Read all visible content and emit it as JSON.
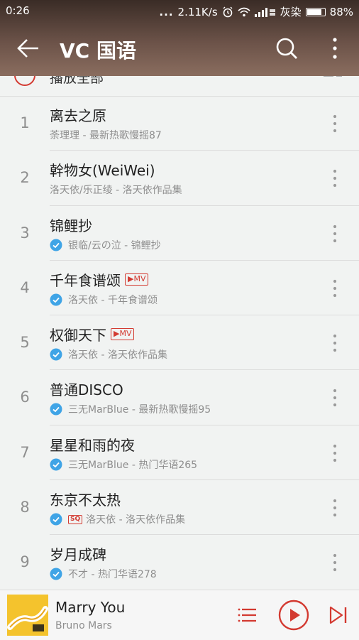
{
  "status_bar": {
    "time": "0:26",
    "dots": "...",
    "speed": "2.11K/s",
    "carrier": "灰染",
    "battery_text": "88%",
    "battery_level": 0.88
  },
  "header": {
    "title": "VC 国语",
    "back_icon": "back-arrow-icon",
    "search_icon": "search-icon",
    "more_icon": "more-vertical-icon"
  },
  "play_all": {
    "label": "播放全部"
  },
  "songs": [
    {
      "index": "1",
      "title": "离去之原",
      "subtitle": "荼理理 - 最新热歌慢摇87",
      "verified": false,
      "mv": false,
      "sq": false
    },
    {
      "index": "2",
      "title": "幹物女(WeiWei)",
      "subtitle": "洛天依/乐正绫 - 洛天依作品集",
      "verified": false,
      "mv": false,
      "sq": false
    },
    {
      "index": "3",
      "title": "锦鲤抄",
      "subtitle": "银临/云の泣 - 锦鲤抄",
      "verified": true,
      "mv": false,
      "sq": false
    },
    {
      "index": "4",
      "title": "千年食谱颂",
      "subtitle": "洛天依 - 千年食谱颂",
      "verified": true,
      "mv": true,
      "sq": false
    },
    {
      "index": "5",
      "title": "权御天下",
      "subtitle": "洛天依 - 洛天依作品集",
      "verified": true,
      "mv": true,
      "sq": false
    },
    {
      "index": "6",
      "title": "普通DISCO",
      "subtitle": "三无MarBlue - 最新热歌慢摇95",
      "verified": true,
      "mv": false,
      "sq": false
    },
    {
      "index": "7",
      "title": "星星和雨的夜",
      "subtitle": "三无MarBlue - 热门华语265",
      "verified": true,
      "mv": false,
      "sq": false
    },
    {
      "index": "8",
      "title": "东京不太热",
      "subtitle": "洛天依 - 洛天依作品集",
      "verified": true,
      "mv": false,
      "sq": true
    },
    {
      "index": "9",
      "title": "岁月成碑",
      "subtitle": "不才 - 热门华语278",
      "verified": true,
      "mv": false,
      "sq": false
    }
  ],
  "badges": {
    "mv": "▶MV",
    "sq": "SQ"
  },
  "player": {
    "title": "Marry You",
    "artist": "Bruno Mars"
  },
  "colors": {
    "accent": "#d33a31",
    "verified": "#3fa4e6"
  }
}
